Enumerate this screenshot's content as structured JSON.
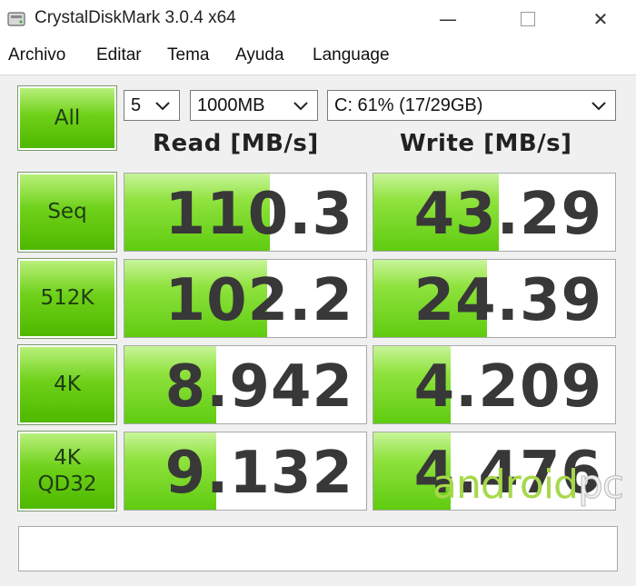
{
  "window": {
    "title": "CrystalDiskMark 3.0.4 x64",
    "minimize_glyph": "—",
    "close_glyph": "✕"
  },
  "menu": [
    "Archivo",
    "Editar",
    "Tema",
    "Ayuda",
    "Language"
  ],
  "controls": {
    "all_label": "All",
    "runs": "5",
    "size": "1000MB",
    "drive": "C: 61% (17/29GB)"
  },
  "columns": {
    "read": "Read [MB/s]",
    "write": "Write [MB/s]"
  },
  "tests": [
    {
      "label": "Seq",
      "label2": "",
      "read": "110.3",
      "write": "43.29",
      "read_fill": 0.6,
      "write_fill": 0.52
    },
    {
      "label": "512K",
      "label2": "",
      "read": "102.2",
      "write": "24.39",
      "read_fill": 0.59,
      "write_fill": 0.47
    },
    {
      "label": "4K",
      "label2": "",
      "read": "8.942",
      "write": "4.209",
      "read_fill": 0.38,
      "write_fill": 0.32
    },
    {
      "label": "4K",
      "label2": "QD32",
      "read": "9.132",
      "write": "4.476",
      "read_fill": 0.38,
      "write_fill": 0.32
    }
  ],
  "watermark": {
    "part1": "android",
    "part2": "pc"
  },
  "colors": {
    "accent_green": "#6fd11a",
    "bar_green": "#8fe23d"
  }
}
